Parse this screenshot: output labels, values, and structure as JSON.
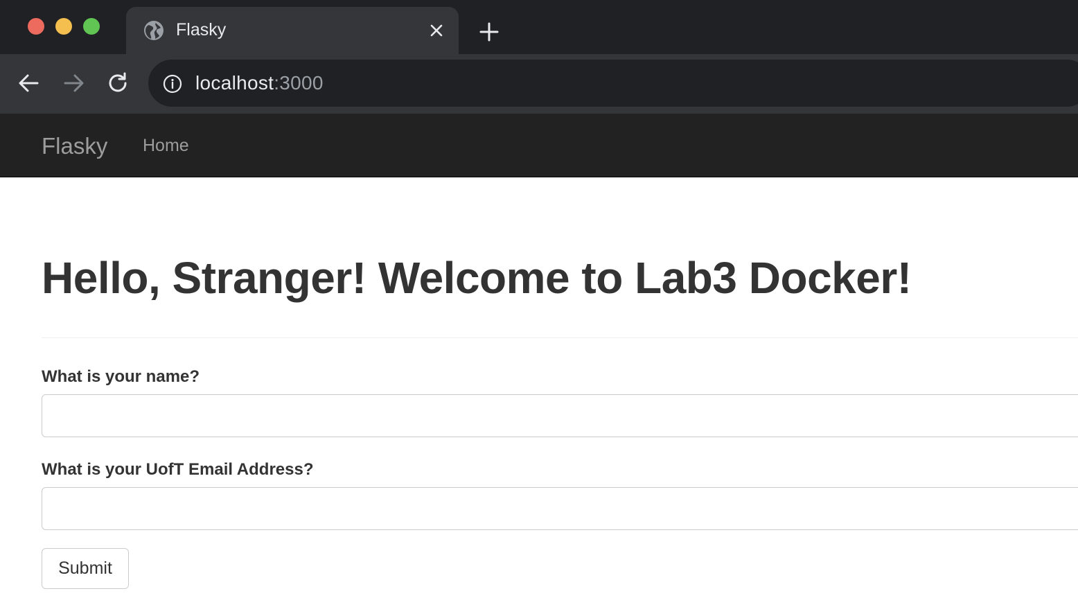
{
  "browser": {
    "tab": {
      "title": "Flasky",
      "icon": "globe-icon"
    },
    "address_bar": {
      "host": "localhost",
      "port": ":3000",
      "icon": "info-icon"
    },
    "controls": [
      "back-icon",
      "forward-icon",
      "reload-icon",
      "close-icon",
      "plus-icon"
    ]
  },
  "navbar": {
    "brand": "Flasky",
    "links": [
      {
        "label": "Home"
      }
    ]
  },
  "main": {
    "heading": "Hello, Stranger! Welcome to Lab3 Docker!",
    "form": {
      "name_label": "What is your name?",
      "name_value": "",
      "email_label": "What is your UofT Email Address?",
      "email_value": "",
      "submit_label": "Submit"
    }
  },
  "colors": {
    "chrome_dark": "#202124",
    "chrome_toolbar": "#35363a",
    "navbar_bg": "#222222",
    "navbar_text": "#9d9d9d",
    "heading_text": "#333333"
  }
}
